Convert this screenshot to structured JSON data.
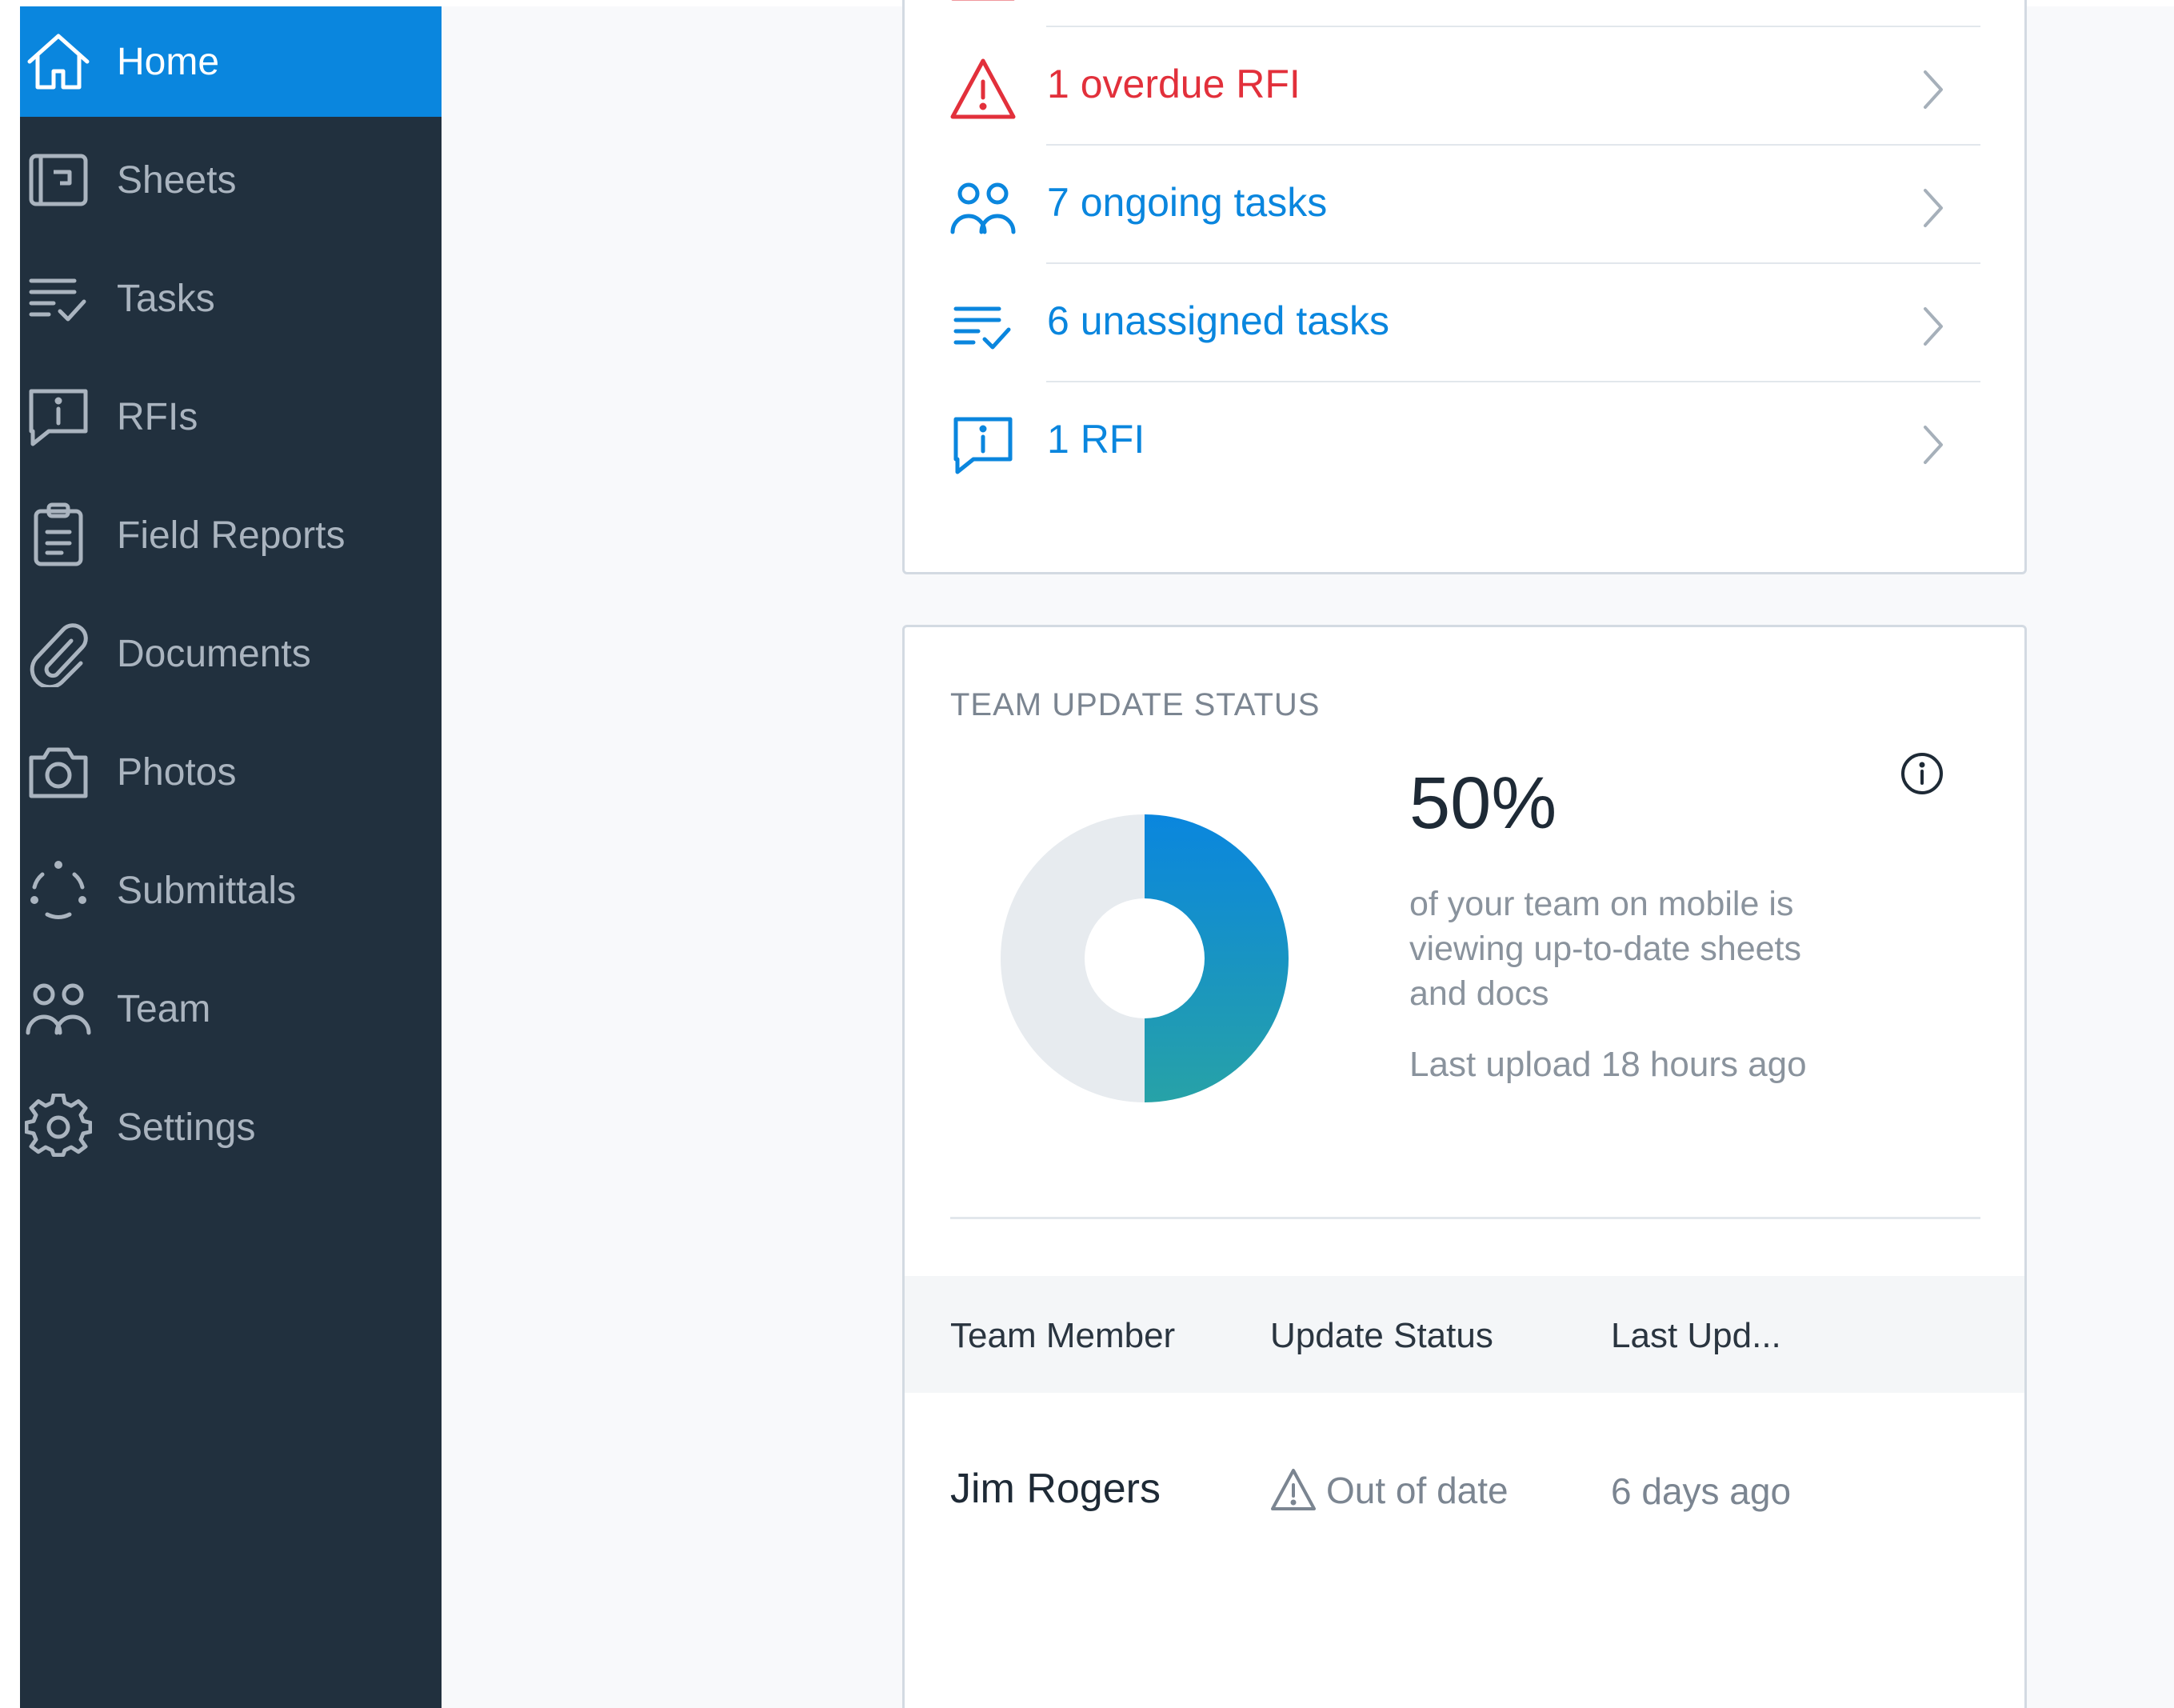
{
  "colors": {
    "sidebar_bg": "#21303e",
    "active_bg": "#0a86de",
    "danger": "#e2303b",
    "link": "#0a86de",
    "donut_start": "#0a86de",
    "donut_end": "#27a2a7",
    "donut_track": "#e7ebef"
  },
  "sidebar": {
    "items": [
      {
        "label": "Home",
        "icon": "home-icon",
        "active": true
      },
      {
        "label": "Sheets",
        "icon": "sheets-icon"
      },
      {
        "label": "Tasks",
        "icon": "tasks-icon"
      },
      {
        "label": "RFIs",
        "icon": "rfi-icon"
      },
      {
        "label": "Field Reports",
        "icon": "clipboard-icon"
      },
      {
        "label": "Documents",
        "icon": "paperclip-icon"
      },
      {
        "label": "Photos",
        "icon": "camera-icon"
      },
      {
        "label": "Submittals",
        "icon": "submittals-icon"
      },
      {
        "label": "Team",
        "icon": "team-icon"
      },
      {
        "label": "Settings",
        "icon": "gear-icon"
      }
    ]
  },
  "alerts": {
    "items": [
      {
        "label": "",
        "icon": "warning-icon",
        "tone": "danger"
      },
      {
        "label": "1 overdue RFI",
        "icon": "warning-icon",
        "tone": "danger"
      },
      {
        "label": "7 ongoing tasks",
        "icon": "team-icon",
        "tone": "link"
      },
      {
        "label": "6 unassigned tasks",
        "icon": "tasks-icon",
        "tone": "link"
      },
      {
        "label": "1 RFI",
        "icon": "rfi-icon",
        "tone": "link"
      }
    ]
  },
  "team_update_status": {
    "title": "TEAM UPDATE STATUS",
    "percent_label": "50%",
    "percent_value": 0.5,
    "description": "of your team on mobile is viewing up-to-date sheets and docs",
    "last_upload": "Last upload 18 hours ago",
    "info_icon": "info-icon",
    "table": {
      "headers": [
        "Team Member",
        "Update Status",
        "Last Upd..."
      ],
      "rows": [
        {
          "member": "Jim Rogers",
          "status": "Out of date",
          "status_icon": "warning-icon",
          "last_updated": "6 days ago"
        }
      ]
    }
  }
}
